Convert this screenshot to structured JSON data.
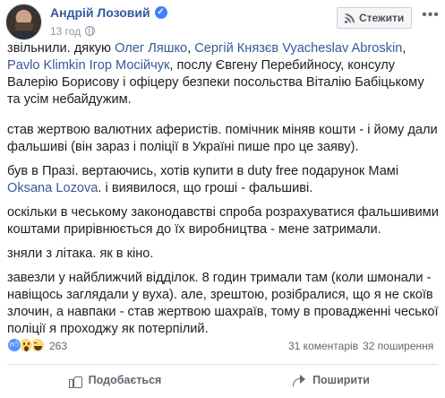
{
  "header": {
    "author": "Андрій Лозовий",
    "time": "13 год",
    "follow_label": "Стежити",
    "more_label": "•••"
  },
  "post": {
    "p1": {
      "t0": "звільнили. дякую ",
      "l1": "Олег Ляшко",
      "t1": ", ",
      "l2": "Сергій Князєв",
      "t2": " ",
      "l3": "Vyacheslav Abroskin",
      "t3": ", ",
      "l4": "Pavlo Klimkin",
      "t4": " ",
      "l5": "Ігор Мосійчук",
      "t5": ", послу Євгену Перебийносу, консулу Валерію Борисову і офіцеру безпеки посольства Віталію Бабіцькому та усім небайдужим."
    },
    "p2": "став жертвою валютних аферистів. помічник міняв кошти - і йому дали фальшиві (він зараз і поліції в Україні пише про це заяву).",
    "p3": {
      "t0": "був в Празі. вертаючись, хотів купити в duty free подарунок Мамі ",
      "l1": "Oksana Lozova",
      "t1": ". і виявилося, що гроші - фальшиві."
    },
    "p4": "оскільки в чеському законодавстві спроба розрахуватися фальшивими коштами прирівнюється до їх виробництва - мене затримали.",
    "p5": "зняли з літака. як в кіно.",
    "p6": "завезли у найближчий відділок. 8 годин тримали там (коли шмонали - навіщось заглядали у вуха). але, зрештою, розібралися, що я не скоїв злочин, а навпаки - став жертвою шахраїв, тому в провадженні чеської поліції я проходжу як потерпілий."
  },
  "stats": {
    "reactions_count": "263",
    "comments": "31 коментарів",
    "shares": "32 поширення"
  },
  "actions": {
    "like_label": "Подобається",
    "share_label": "Поширити"
  },
  "colors": {
    "link": "#365899",
    "text": "#1c1e21",
    "meta": "#90949c",
    "like_blue": "#5890ff"
  },
  "icons": [
    "verified-icon",
    "globe-icon",
    "rss-icon",
    "more-icon",
    "like-icon",
    "wow-icon",
    "haha-icon",
    "thumb-icon",
    "share-icon"
  ]
}
